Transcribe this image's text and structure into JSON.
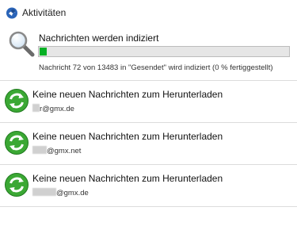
{
  "window": {
    "title": "Aktivitäten",
    "icon": "thunderbird-icon"
  },
  "indexing": {
    "icon": "magnifier-icon",
    "title": "Nachrichten werden indiziert",
    "progress": 0.03,
    "progress_color": "#06b025",
    "detail": "Nachricht 72 von 13483 in \"Gesendet\" wird indiziert (0 % fertiggestellt)"
  },
  "activities": [
    {
      "icon": "sync-icon",
      "title": "Keine neuen Nachrichten zum Herunterladen",
      "account": "r@gmx.de"
    },
    {
      "icon": "sync-icon",
      "title": "Keine neuen Nachrichten zum Herunterladen",
      "account": "@gmx.net"
    },
    {
      "icon": "sync-icon",
      "title": "Keine neuen Nachrichten zum Herunterladen",
      "account": "@gmx.de"
    }
  ]
}
